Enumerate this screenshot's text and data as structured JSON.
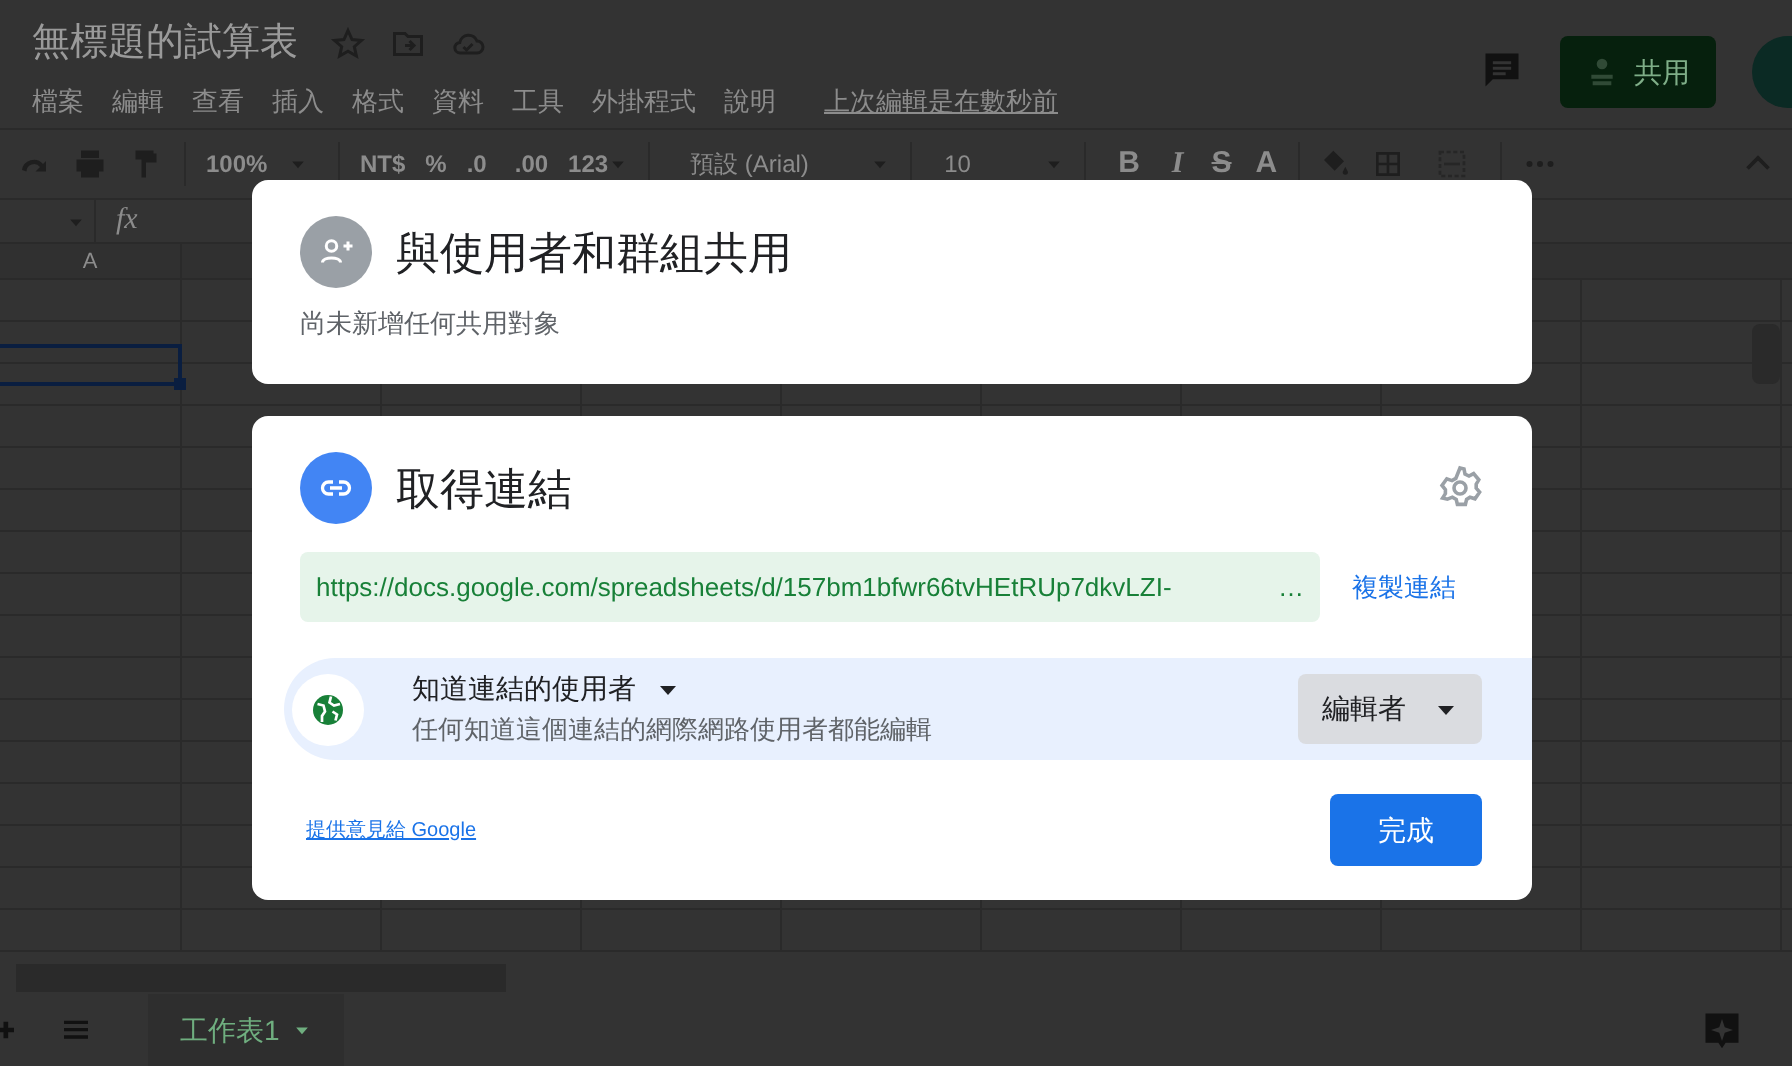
{
  "doc_title": "無標題的試算表",
  "menu": [
    "檔案",
    "編輯",
    "查看",
    "插入",
    "格式",
    "資料",
    "工具",
    "外掛程式",
    "說明"
  ],
  "last_edit": "上次編輯是在數秒前",
  "share_button": "共用",
  "toolbar": {
    "zoom": "100%",
    "currency": "NT$",
    "percent": "%",
    "decrease_decimal": ".0",
    "increase_decimal": ".00",
    "more_formats": "123",
    "font": "預設 (Arial)",
    "font_size": "10",
    "bold": "B",
    "italic": "I",
    "strikethrough": "S",
    "text_color": "A"
  },
  "function_label": "fx",
  "column_header": "A",
  "sheet_tab": {
    "label": "工作表1",
    "selected": true
  },
  "share_card": {
    "title": "與使用者和群組共用",
    "subtitle": "尚未新增任何共用對象"
  },
  "link_card": {
    "title": "取得連結",
    "url": "https://docs.google.com/spreadsheets/d/157bm1bfwr66tvHEtRUp7dkvLZI-",
    "url_ellipsis": "…",
    "copy_link": "複製連結",
    "access": {
      "label": "知道連結的使用者",
      "description": "任何知道這個連結的網際網路使用者都能編輯",
      "role": "編輯者"
    },
    "feedback_link": "提供意見給 Google",
    "done_button": "完成"
  }
}
